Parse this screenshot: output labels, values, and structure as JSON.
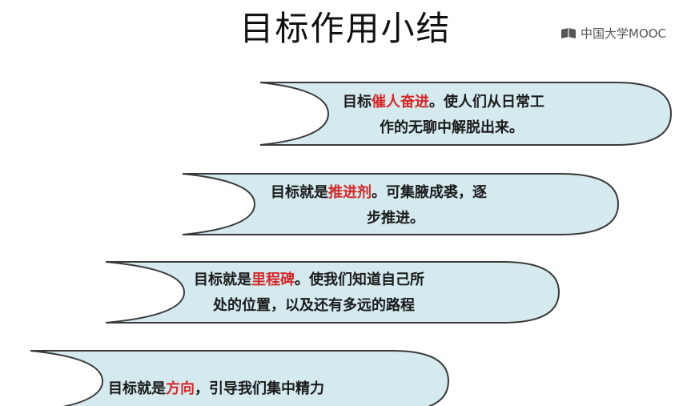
{
  "slide": {
    "title": "目标作用小结",
    "brand": "中国大学MOOC"
  },
  "cards": [
    {
      "prefix": "目标",
      "highlight": "催人奋进",
      "line1_rest": "。使人们从日常工",
      "line2": "作的无聊中解脱出来。"
    },
    {
      "prefix": "目标就是",
      "highlight": "推进剂",
      "line1_rest": "。可集腋成裘，逐",
      "line2": "步推进。"
    },
    {
      "prefix": "目标就是",
      "highlight": "里程碑",
      "line1_rest": "。使我们知道自己所",
      "line2": "处的位置，以及还有多远的路程"
    },
    {
      "prefix": "目标就是",
      "highlight": "方向",
      "line1_rest": "，引导我们集中精力",
      "line2": ""
    }
  ],
  "colors": {
    "card_fill": "#d4eaef",
    "card_stroke": "#3a3a3a",
    "highlight": "#d62828"
  }
}
